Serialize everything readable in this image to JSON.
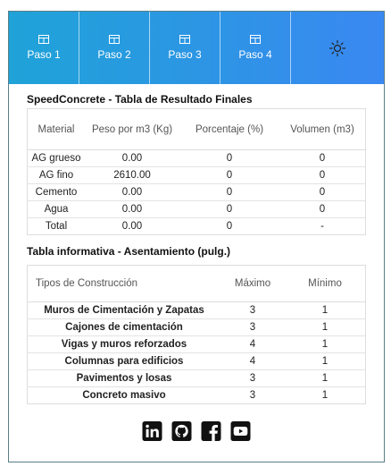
{
  "nav": {
    "tabs": [
      {
        "label": "Paso 1"
      },
      {
        "label": "Paso 2"
      },
      {
        "label": "Paso 3"
      },
      {
        "label": "Paso 4"
      }
    ],
    "theme_icon": "sun-icon",
    "gradient": [
      "#1fa3d8",
      "#3a88f2"
    ]
  },
  "results": {
    "title": "SpeedConcrete - Tabla de Resultado Finales",
    "headers": [
      "Material",
      "Peso por m3 (Kg)",
      "Porcentaje (%)",
      "Volumen (m3)"
    ],
    "rows": [
      [
        "AG grueso",
        "0.00",
        "0",
        "0"
      ],
      [
        "AG fino",
        "2610.00",
        "0",
        "0"
      ],
      [
        "Cemento",
        "0.00",
        "0",
        "0"
      ],
      [
        "Agua",
        "0.00",
        "0",
        "0"
      ],
      [
        "Total",
        "0.00",
        "0",
        "-"
      ]
    ]
  },
  "info": {
    "title": "Tabla informativa - Asentamiento (pulg.)",
    "headers": [
      "Tipos de Construcción",
      "Máximo",
      "Mínimo"
    ],
    "rows": [
      [
        "Muros de Cimentación y Zapatas",
        "3",
        "1"
      ],
      [
        "Cajones de cimentación",
        "3",
        "1"
      ],
      [
        "Vigas y muros reforzados",
        "4",
        "1"
      ],
      [
        "Columnas para edificios",
        "4",
        "1"
      ],
      [
        "Pavimentos y losas",
        "3",
        "1"
      ],
      [
        "Concreto masivo",
        "3",
        "1"
      ]
    ]
  },
  "social": [
    "linkedin-icon",
    "github-icon",
    "facebook-icon",
    "youtube-icon"
  ]
}
